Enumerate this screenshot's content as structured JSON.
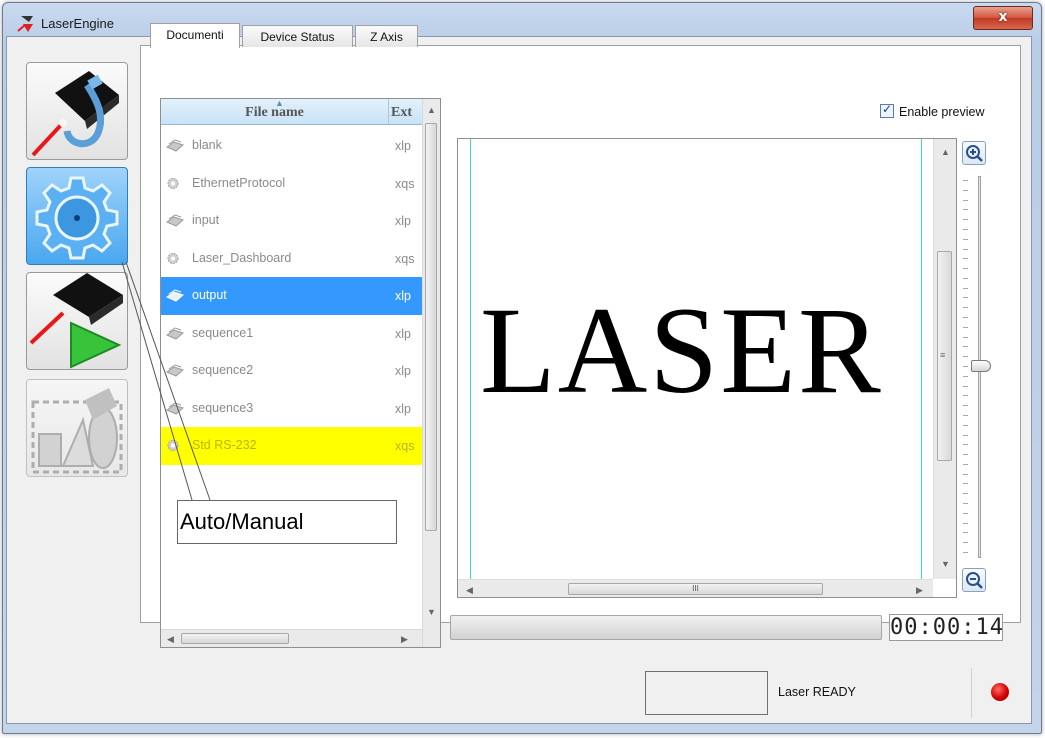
{
  "window": {
    "title": "LaserEngine",
    "close_label": "x"
  },
  "toolbar": {
    "buttons": [
      {
        "name": "laser-connect",
        "state": "normal"
      },
      {
        "name": "settings",
        "state": "selected"
      },
      {
        "name": "run-sequence",
        "state": "normal"
      },
      {
        "name": "graphic-editor",
        "state": "disabled"
      }
    ]
  },
  "tabs": [
    {
      "label": "Documenti",
      "active": true
    },
    {
      "label": "Device Status",
      "active": false
    },
    {
      "label": "Z Axis",
      "active": false
    }
  ],
  "filelist": {
    "col_name": "File name",
    "col_ext": "Ext",
    "rows": [
      {
        "name": "blank",
        "ext": "xlp",
        "icon": "document-icon",
        "state": "normal"
      },
      {
        "name": "EthernetProtocol",
        "ext": "xqs",
        "icon": "gear-icon",
        "state": "normal"
      },
      {
        "name": "input",
        "ext": "xlp",
        "icon": "document-icon",
        "state": "normal"
      },
      {
        "name": "Laser_Dashboard",
        "ext": "xqs",
        "icon": "gear-icon",
        "state": "normal"
      },
      {
        "name": "output",
        "ext": "xlp",
        "icon": "document-icon",
        "state": "selected"
      },
      {
        "name": "sequence1",
        "ext": "xlp",
        "icon": "document-icon",
        "state": "normal"
      },
      {
        "name": "sequence2",
        "ext": "xlp",
        "icon": "document-icon",
        "state": "normal"
      },
      {
        "name": "sequence3",
        "ext": "xlp",
        "icon": "document-icon",
        "state": "normal"
      },
      {
        "name": "Std RS-232",
        "ext": "xqs",
        "icon": "gear-icon",
        "state": "highlighted"
      }
    ]
  },
  "preview": {
    "enable_label": "Enable preview",
    "enabled": true,
    "text": "LASER",
    "hscroll_grip": "III",
    "vscroll_grip": "≡"
  },
  "zoom": {
    "in_icon": "zoom-in-icon",
    "out_icon": "zoom-out-icon",
    "level": 0.5
  },
  "timer": "00:00:14",
  "status": {
    "text": "Laser READY",
    "led_color": "#d40000"
  },
  "callout": {
    "text": "Auto/Manual"
  },
  "colors": {
    "selection": "#3399ff",
    "highlight": "#ffff00",
    "guide_lines": "#3fd3e6"
  }
}
